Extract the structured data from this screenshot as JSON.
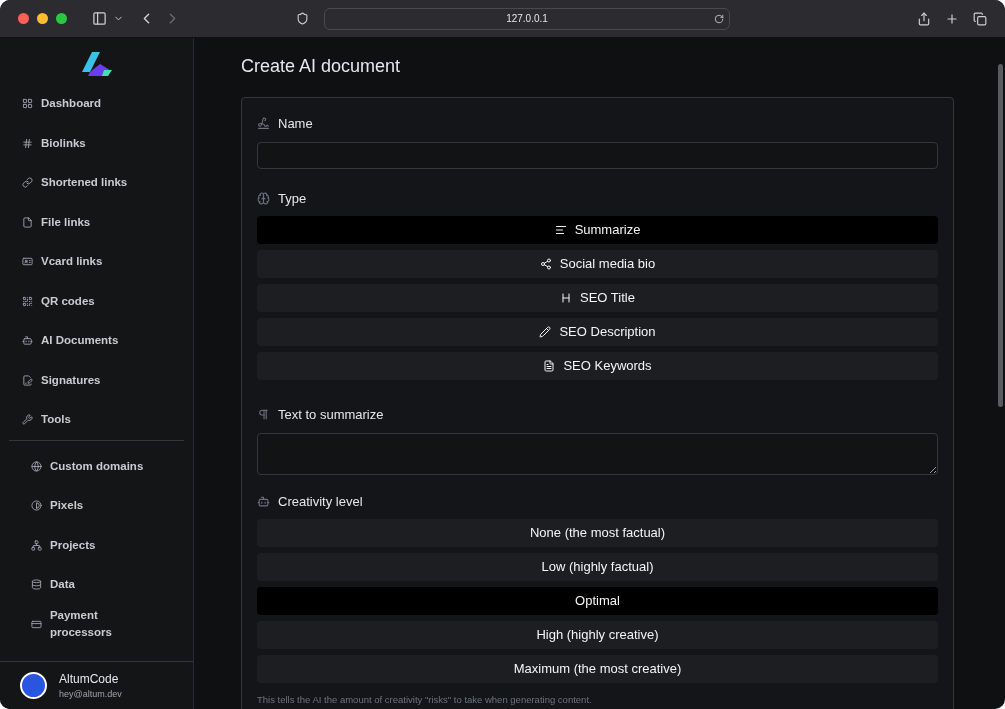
{
  "browser": {
    "url": "127.0.0.1"
  },
  "sidebar": {
    "groups": [
      [
        {
          "label": "Dashboard"
        },
        {
          "label": "Biolinks"
        },
        {
          "label": "Shortened links"
        },
        {
          "label": "File links"
        },
        {
          "label": "Vcard links"
        },
        {
          "label": "QR codes"
        },
        {
          "label": "AI Documents"
        },
        {
          "label": "Signatures"
        },
        {
          "label": "Tools"
        }
      ],
      [
        {
          "label": "Custom domains"
        },
        {
          "label": "Pixels"
        },
        {
          "label": "Projects"
        },
        {
          "label": "Data"
        },
        {
          "label": "Payment processors"
        }
      ]
    ],
    "user": {
      "name": "AltumCode",
      "email": "hey@altum.dev"
    }
  },
  "page": {
    "title": "Create AI document"
  },
  "form": {
    "name": {
      "label": "Name"
    },
    "type": {
      "label": "Type",
      "options": [
        {
          "label": "Summarize",
          "selected": true
        },
        {
          "label": "Social media bio",
          "selected": false
        },
        {
          "label": "SEO Title",
          "selected": false
        },
        {
          "label": "SEO Description",
          "selected": false
        },
        {
          "label": "SEO Keywords",
          "selected": false
        }
      ]
    },
    "text": {
      "label": "Text to summarize"
    },
    "creativity": {
      "label": "Creativity level",
      "options": [
        {
          "label": "None (the most factual)",
          "selected": false
        },
        {
          "label": "Low (highly factual)",
          "selected": false
        },
        {
          "label": "Optimal",
          "selected": true
        },
        {
          "label": "High (highly creative)",
          "selected": false
        },
        {
          "label": "Maximum (the most creative)",
          "selected": false
        }
      ],
      "help": "This tells the AI the amount of creativity \"risks\" to take when generating content."
    }
  }
}
